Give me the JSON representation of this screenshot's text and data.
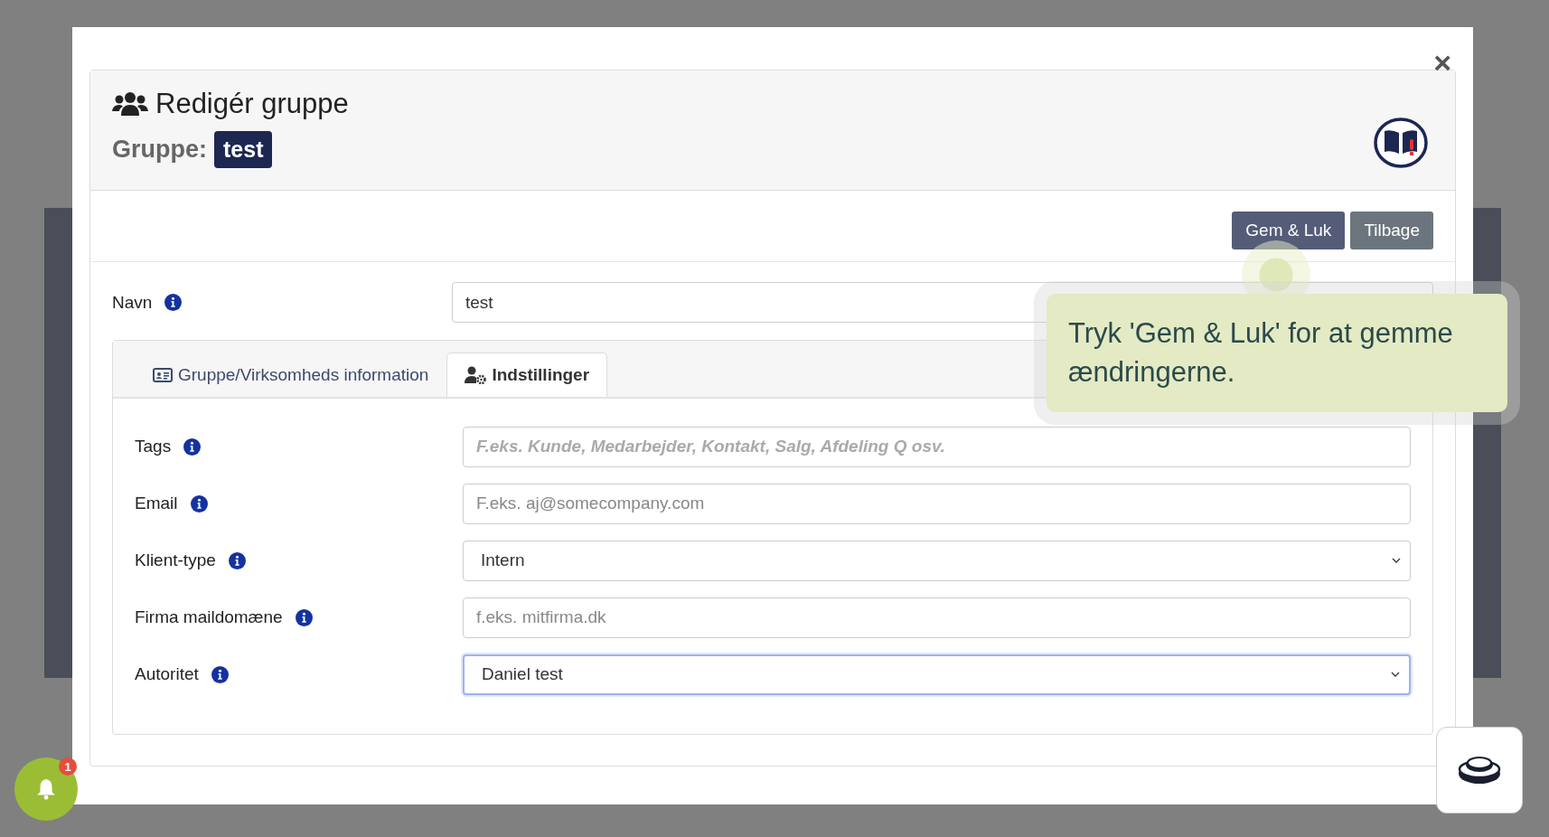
{
  "modal": {
    "title": "Redigér gruppe",
    "group_label": "Gruppe:",
    "group_badge": "test",
    "close": "×"
  },
  "buttons": [
    {
      "label": "Gem & Luk",
      "kind": "primary"
    },
    {
      "label": "Tilbage",
      "kind": "secondary"
    }
  ],
  "name_field": {
    "label": "Navn",
    "value": "test"
  },
  "tabs": [
    {
      "label": "Gruppe/Virksomheds information",
      "selected": false
    },
    {
      "label": "Indstillinger",
      "selected": true
    }
  ],
  "fields": [
    {
      "label": "Tags",
      "kind": "text",
      "placeholder": "F.eks. Kunde, Medarbejder, Kontakt, Salg, Afdeling Q osv.",
      "emphasis": true,
      "focused": false
    },
    {
      "label": "Email",
      "kind": "text",
      "placeholder": "F.eks. aj@somecompany.com",
      "emphasis": false,
      "focused": false
    },
    {
      "label": "Klient-type",
      "kind": "select",
      "value": "Intern",
      "focused": false
    },
    {
      "label": "Firma maildomæne",
      "kind": "text",
      "placeholder": "f.eks. mitfirma.dk",
      "emphasis": false,
      "focused": false
    },
    {
      "label": "Autoritet",
      "kind": "select",
      "value": "Daniel test",
      "focused": true
    }
  ],
  "tooltip": {
    "text": "Tryk 'Gem & Luk' for at gemme ændringerne."
  },
  "notifications": {
    "count": "1"
  }
}
